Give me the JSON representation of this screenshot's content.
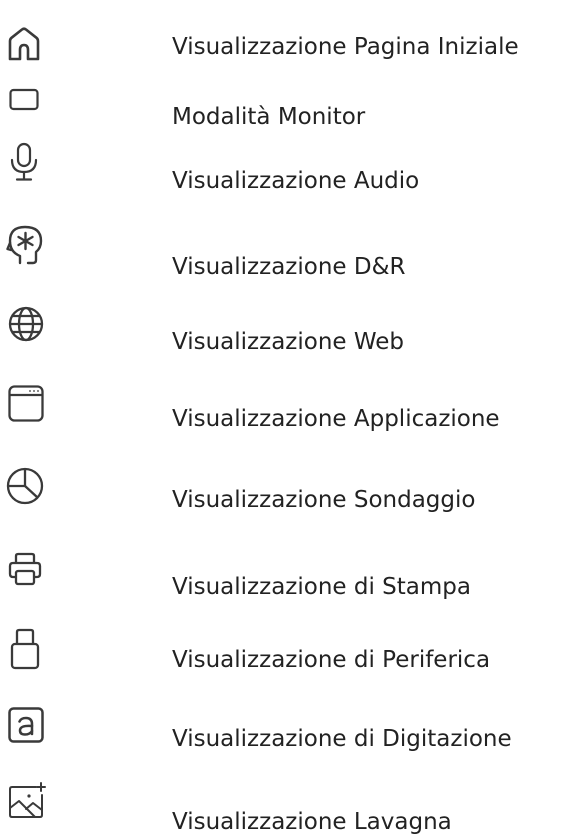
{
  "icon_color": "#3a3a3a",
  "items": [
    {
      "icon": "home-icon",
      "label": "Visualizzazione Pagina Iniziale"
    },
    {
      "icon": "monitor-icon",
      "label": "Modalità Monitor"
    },
    {
      "icon": "microphone-icon",
      "label": "Visualizzazione Audio"
    },
    {
      "icon": "head-asterisk-icon",
      "label": "Visualizzazione D&R"
    },
    {
      "icon": "globe-icon",
      "label": "Visualizzazione Web"
    },
    {
      "icon": "application-window-icon",
      "label": "Visualizzazione Applicazione"
    },
    {
      "icon": "pie-chart-icon",
      "label": "Visualizzazione Sondaggio"
    },
    {
      "icon": "printer-icon",
      "label": "Visualizzazione di Stampa"
    },
    {
      "icon": "usb-drive-icon",
      "label": "Visualizzazione di Periferica"
    },
    {
      "icon": "keyboard-letter-a-icon",
      "label": "Visualizzazione di Digitazione"
    },
    {
      "icon": "whiteboard-image-icon",
      "label": "Visualizzazione Lavagna"
    }
  ]
}
